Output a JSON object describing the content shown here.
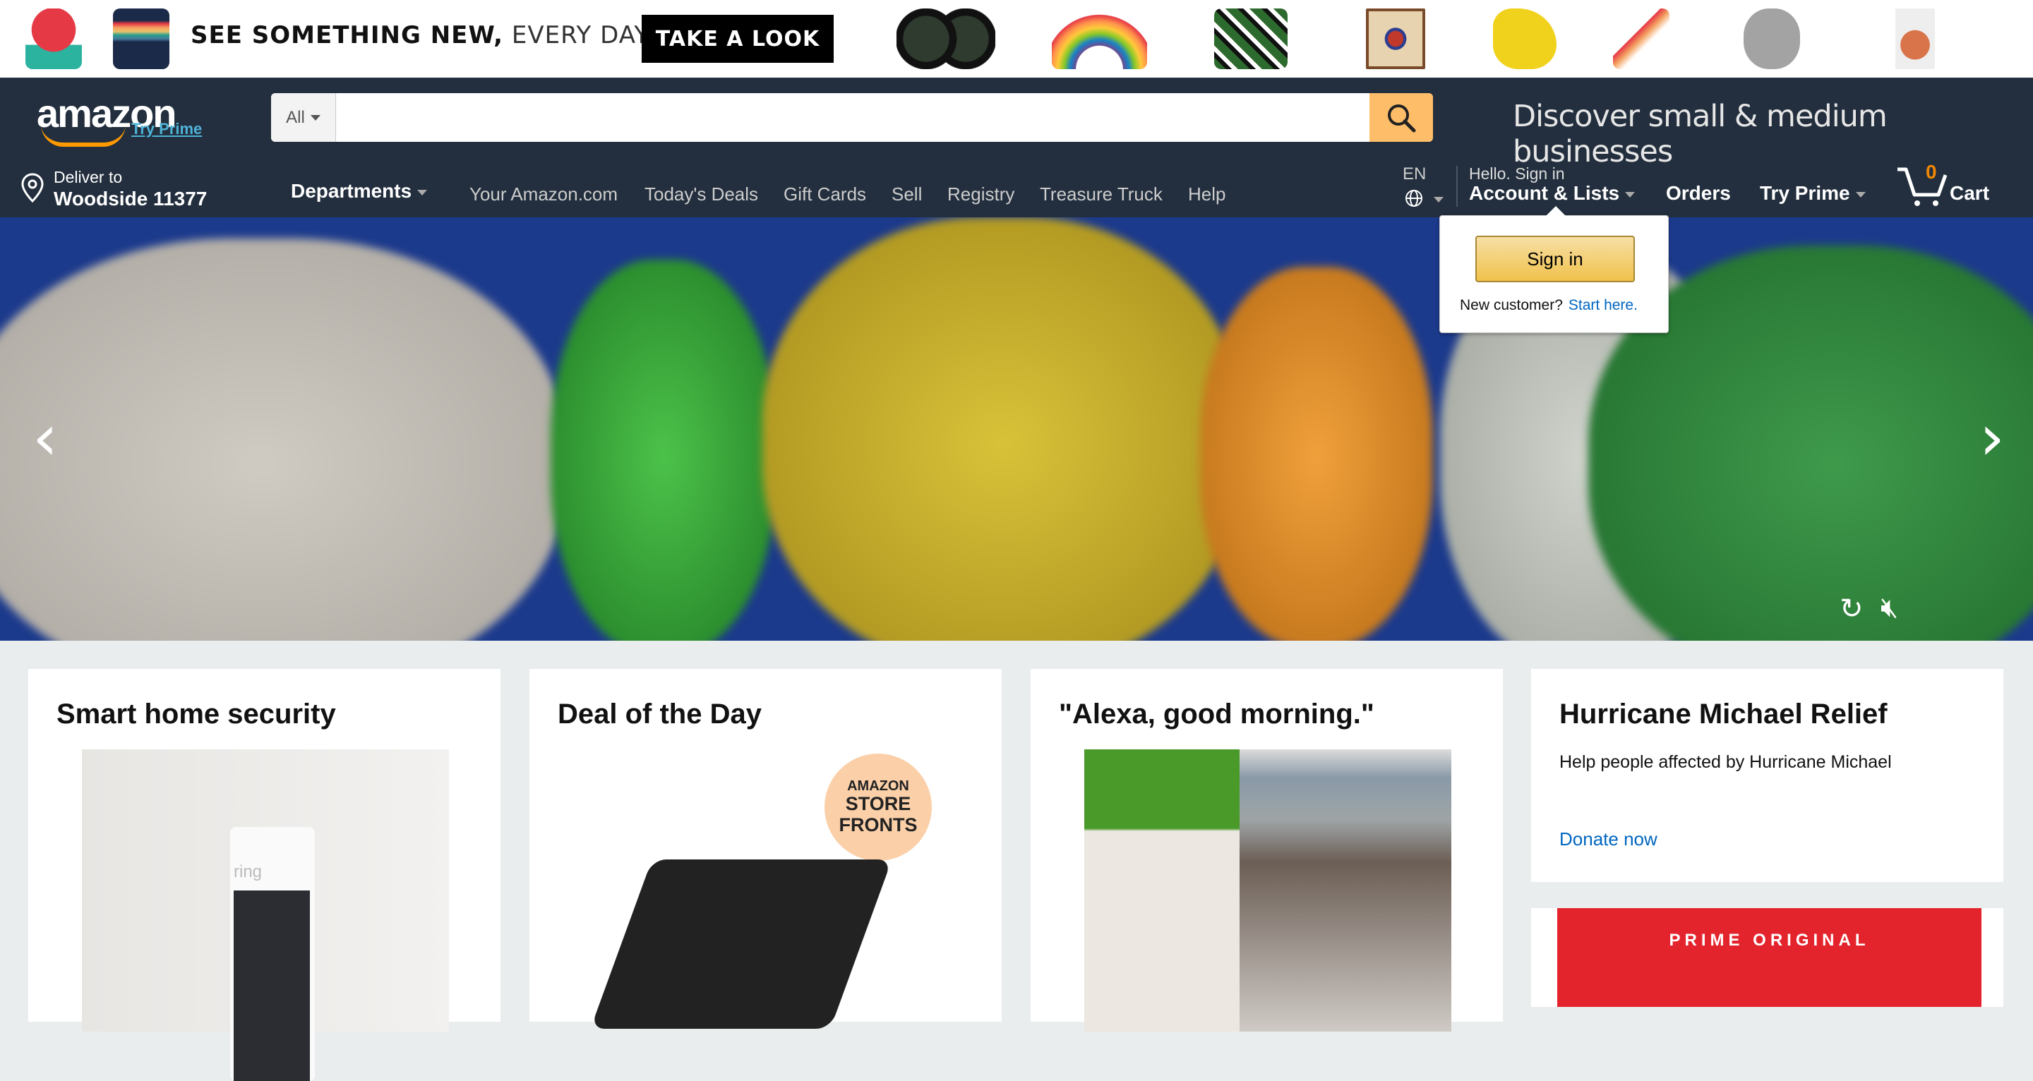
{
  "ad": {
    "headline_bold": "SEE SOMETHING NEW,",
    "headline_light": "EVERY DAY.",
    "button": "TAKE A LOOK"
  },
  "header": {
    "logo": "amazon",
    "try_prime_logo": "Try Prime",
    "search_category": "All",
    "search_placeholder": "",
    "discover": "Discover small & medium businesses"
  },
  "nav": {
    "deliver_label": "Deliver to",
    "deliver_location": "Woodside 11377",
    "departments": "Departments",
    "links": [
      "Your Amazon.com",
      "Today's Deals",
      "Gift Cards",
      "Sell",
      "Registry",
      "Treasure Truck",
      "Help"
    ],
    "lang": "EN",
    "hello": "Hello. Sign in",
    "account": "Account & Lists",
    "orders": "Orders",
    "try_prime": "Try Prime",
    "cart_count": "0",
    "cart": "Cart"
  },
  "popup": {
    "signin": "Sign in",
    "new_customer": "New customer?",
    "start_here": "Start here."
  },
  "cards": [
    {
      "title": "Smart home security",
      "img_text": "ring"
    },
    {
      "title": "Deal of the Day",
      "badge": [
        "AMAZON",
        "STORE",
        "FRONTS"
      ]
    },
    {
      "title": "\"Alexa, good morning.\""
    },
    {
      "title": "Hurricane Michael Relief",
      "text": "Help people affected by Hurricane Michael",
      "link": "Donate now"
    }
  ],
  "promo": {
    "label": "PRIME ORIGINAL"
  }
}
